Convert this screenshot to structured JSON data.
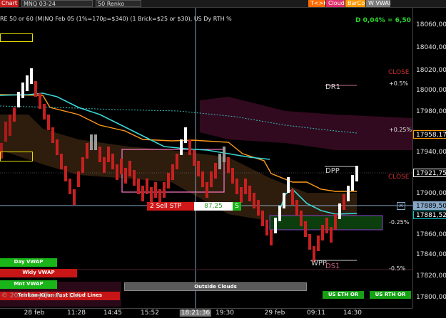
{
  "toolbar": {
    "chart_label": "Chart",
    "instrument": "MNQ 03-24",
    "bar_type": "50 Renko",
    "buttons": [
      {
        "label": "T<>K",
        "color": "#ff6a00"
      },
      {
        "label": "Cloud",
        "color": "#e0306b"
      },
      {
        "label": "BarCol",
        "color": "#ff9900"
      },
      {
        "label": "W VWAP",
        "color": "#7a7a7a"
      }
    ]
  },
  "chart": {
    "info_line": "RE 50 or 60 (M)NQ Feb 05 (1%=170p=$340) (1 Brick=$25 or $30), US Dy RTH %",
    "change": "D 0,04% = 6,50",
    "price_labels": {
      "close_upper": "CLOSE",
      "plus_0_5": "+0.5%",
      "plus_0_25": "+0.25%",
      "close_lower": "CLOSE",
      "minus_0_25": "-0.25%",
      "minus_0_5": "-0.5%",
      "dr1": "DR1",
      "dpp": "DPP",
      "ds1": "DS1",
      "wpp": "WPP"
    },
    "sell_stop": {
      "label": "2  Sell STP",
      "value": "87,25",
      "badge": "S"
    },
    "outside_clouds": "Outside Clouds",
    "copyright": "© 2024 NinjaTrader, LLC",
    "legend": [
      {
        "label": "Day VWAP",
        "color": "#19b519"
      },
      {
        "label": "Wkly VWAP",
        "color": "#c81515"
      },
      {
        "label": "Mnt VWAP",
        "color": "#19b519"
      },
      {
        "label": "Tenkan-Kijun Fast Cloud Lines",
        "color": "#c81515"
      }
    ],
    "session_buttons": [
      {
        "label": "US ETH OR",
        "color": "#15a015"
      },
      {
        "label": "US RTH OR",
        "color": "#15a015"
      }
    ]
  },
  "y_axis": {
    "ticks": [
      "18060,00",
      "18040,00",
      "18020,00",
      "18000,00",
      "17980,00",
      "17940,00",
      "17900,00",
      "17860,00",
      "17840,00",
      "17820,00",
      "17800,00"
    ],
    "labels": [
      {
        "text": "17958,17",
        "bg": "#000000",
        "fg": "#ffffff",
        "border": "#ff9900"
      },
      {
        "text": "17921,75",
        "bg": "#000000",
        "fg": "#ffffff",
        "border": "#ffffff"
      },
      {
        "text": "17889,50",
        "bg": "#87a7c7",
        "fg": "#000000",
        "border": "#87a7c7"
      },
      {
        "text": "17881,52",
        "bg": "#000000",
        "fg": "#ffffff",
        "border": "#00c8c8"
      }
    ]
  },
  "x_axis": {
    "ticks": [
      "28 feb",
      "11:28",
      "14:45",
      "15:52",
      "18:21:36",
      "19:30",
      "29 feb",
      "09:11",
      "14:30"
    ]
  }
}
